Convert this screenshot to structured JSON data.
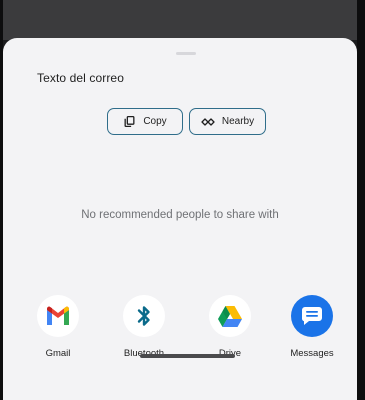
{
  "sheet": {
    "title": "Texto del correo",
    "empty_message": "No recommended people to share with"
  },
  "actions": [
    {
      "label": "Copy",
      "icon": "copy-icon"
    },
    {
      "label": "Nearby",
      "icon": "nearby-share-icon"
    }
  ],
  "apps": [
    {
      "label": "Gmail",
      "icon": "gmail-icon"
    },
    {
      "label": "Bluetooth",
      "icon": "bluetooth-icon"
    },
    {
      "label": "Drive",
      "icon": "drive-icon"
    },
    {
      "label": "Messages",
      "icon": "messages-icon"
    }
  ],
  "colors": {
    "chip_border": "#2f6d8a",
    "sheet_background": "#f3f3f5",
    "messages_blue": "#1a73e8",
    "bluetooth_blue": "#0a6a8a"
  }
}
